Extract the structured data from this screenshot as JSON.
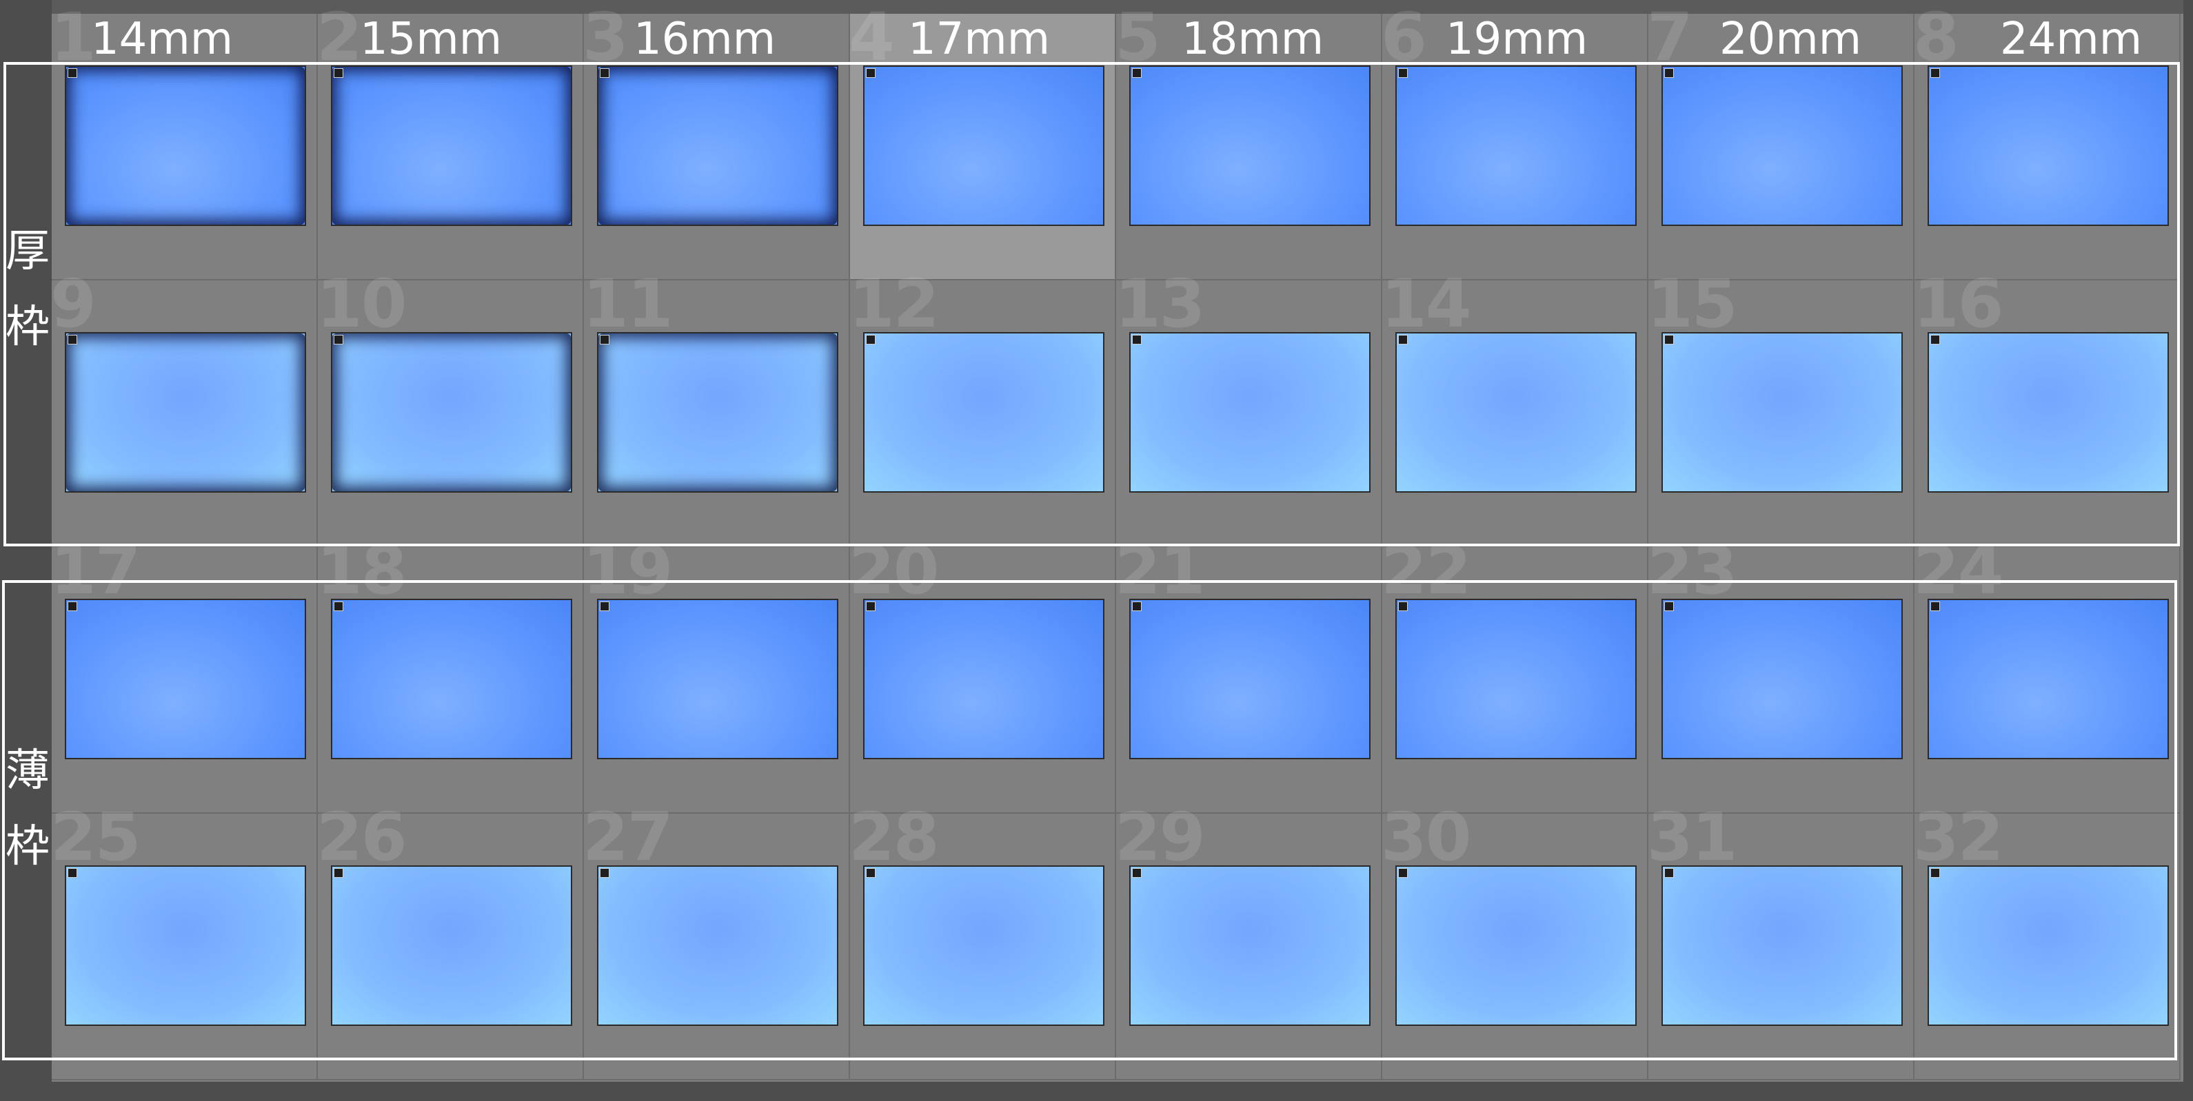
{
  "columns": [
    "14mm",
    "15mm",
    "16mm",
    "17mm",
    "18mm",
    "19mm",
    "20mm",
    "24mm"
  ],
  "groups": [
    {
      "label_chars": [
        "厚",
        "枠"
      ]
    },
    {
      "label_chars": [
        "薄",
        "枠"
      ]
    }
  ],
  "cells": [
    {
      "index": "1"
    },
    {
      "index": "2"
    },
    {
      "index": "3"
    },
    {
      "index": "4"
    },
    {
      "index": "5"
    },
    {
      "index": "6"
    },
    {
      "index": "7"
    },
    {
      "index": "8"
    },
    {
      "index": "9"
    },
    {
      "index": "10"
    },
    {
      "index": "11"
    },
    {
      "index": "12"
    },
    {
      "index": "13"
    },
    {
      "index": "14"
    },
    {
      "index": "15"
    },
    {
      "index": "16"
    },
    {
      "index": "17"
    },
    {
      "index": "18"
    },
    {
      "index": "19"
    },
    {
      "index": "20"
    },
    {
      "index": "21"
    },
    {
      "index": "22"
    },
    {
      "index": "23"
    },
    {
      "index": "24"
    },
    {
      "index": "25"
    },
    {
      "index": "26"
    },
    {
      "index": "27"
    },
    {
      "index": "28"
    },
    {
      "index": "29"
    },
    {
      "index": "30"
    },
    {
      "index": "31"
    },
    {
      "index": "32"
    }
  ],
  "selected_index": "4",
  "vignetted_indices": [
    "1",
    "2",
    "3",
    "9",
    "10",
    "11"
  ],
  "colors": {
    "sky_dark": "#4a86f7",
    "sky_light": "#93d4ff",
    "cell_background": "#808080",
    "selected_cell_background": "#9a9a9a"
  }
}
